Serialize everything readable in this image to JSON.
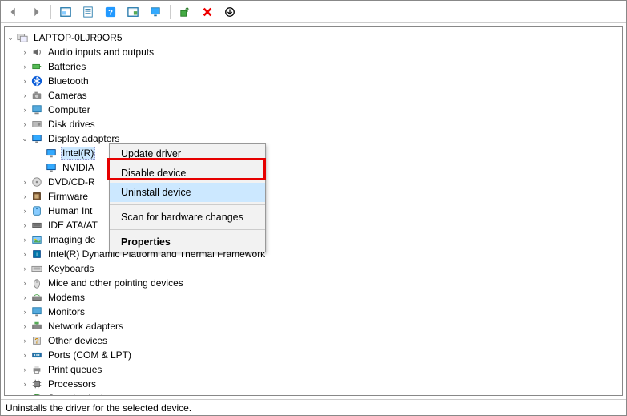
{
  "toolbar": {
    "buttons": [
      {
        "name": "back-button",
        "icon": "arrow-left-icon"
      },
      {
        "name": "forward-button",
        "icon": "arrow-right-icon"
      },
      {
        "sep": true
      },
      {
        "name": "show-hidden-button",
        "icon": "panel-icon"
      },
      {
        "name": "properties-button",
        "icon": "page-icon"
      },
      {
        "name": "help-button",
        "icon": "help-icon"
      },
      {
        "name": "console-button",
        "icon": "console-icon"
      },
      {
        "name": "computer-button",
        "icon": "monitor-icon"
      },
      {
        "sep": true
      },
      {
        "name": "update-button",
        "icon": "device-up-icon"
      },
      {
        "name": "remove-button",
        "icon": "red-x-icon"
      },
      {
        "name": "scan-button",
        "icon": "down-circle-icon"
      }
    ]
  },
  "tree": {
    "root": {
      "label": "LAPTOP-0LJR9OR5",
      "icon": "computer-root-icon",
      "expanded": true
    },
    "items": [
      {
        "label": "Audio inputs and outputs",
        "icon": "audio-icon",
        "expanded": false
      },
      {
        "label": "Batteries",
        "icon": "battery-icon",
        "expanded": false
      },
      {
        "label": "Bluetooth",
        "icon": "bluetooth-icon",
        "expanded": false
      },
      {
        "label": "Cameras",
        "icon": "camera-icon",
        "expanded": false
      },
      {
        "label": "Computer",
        "icon": "computer-icon",
        "expanded": false
      },
      {
        "label": "Disk drives",
        "icon": "disk-icon",
        "expanded": false
      },
      {
        "label": "Display adapters",
        "icon": "display-icon",
        "expanded": true,
        "children": [
          {
            "label": "Intel(R)",
            "icon": "display-icon",
            "selected": true
          },
          {
            "label": "NVIDIA",
            "icon": "display-icon"
          }
        ]
      },
      {
        "label": "DVD/CD-R",
        "icon": "dvd-icon",
        "expanded": false,
        "truncated": true
      },
      {
        "label": "Firmware",
        "icon": "firmware-icon",
        "expanded": false
      },
      {
        "label": "Human Int",
        "icon": "hid-icon",
        "expanded": false,
        "truncated": true
      },
      {
        "label": "IDE ATA/AT",
        "icon": "ide-icon",
        "expanded": false,
        "truncated": true
      },
      {
        "label": "Imaging de",
        "icon": "imaging-icon",
        "expanded": false,
        "truncated": true
      },
      {
        "label": "Intel(R) Dynamic Platform and Thermal Framework",
        "icon": "intel-icon",
        "expanded": false
      },
      {
        "label": "Keyboards",
        "icon": "keyboard-icon",
        "expanded": false
      },
      {
        "label": "Mice and other pointing devices",
        "icon": "mouse-icon",
        "expanded": false
      },
      {
        "label": "Modems",
        "icon": "modem-icon",
        "expanded": false
      },
      {
        "label": "Monitors",
        "icon": "monitor-dev-icon",
        "expanded": false
      },
      {
        "label": "Network adapters",
        "icon": "network-icon",
        "expanded": false
      },
      {
        "label": "Other devices",
        "icon": "other-icon",
        "expanded": false
      },
      {
        "label": "Ports (COM & LPT)",
        "icon": "port-icon",
        "expanded": false
      },
      {
        "label": "Print queues",
        "icon": "printer-icon",
        "expanded": false
      },
      {
        "label": "Processors",
        "icon": "cpu-icon",
        "expanded": false
      },
      {
        "label": "Security devices",
        "icon": "security-icon",
        "expanded": false,
        "cut": true
      }
    ]
  },
  "context_menu": {
    "items": [
      {
        "label": "Update driver"
      },
      {
        "label": "Disable device"
      },
      {
        "label": "Uninstall device",
        "highlighted": true,
        "boxed": true
      },
      {
        "sep": true
      },
      {
        "label": "Scan for hardware changes"
      },
      {
        "sep": true
      },
      {
        "label": "Properties",
        "bold": true
      }
    ]
  },
  "statusbar": {
    "text": "Uninstalls the driver for the selected device."
  }
}
